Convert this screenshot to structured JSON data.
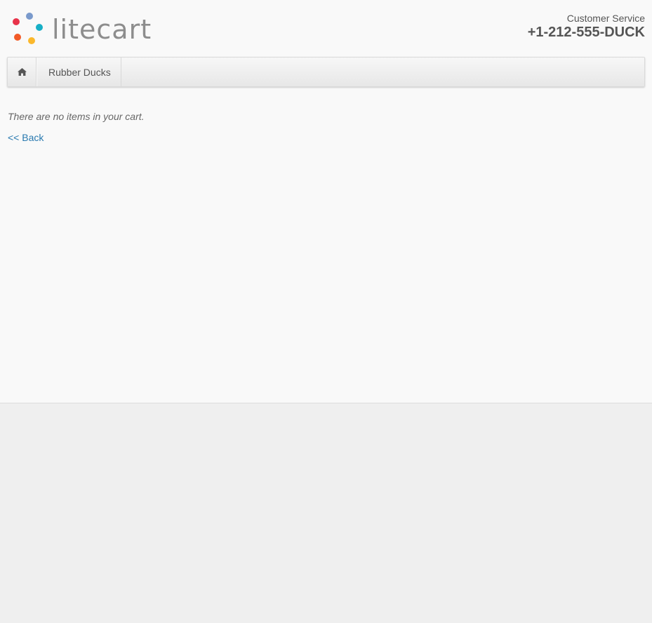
{
  "header": {
    "logo_text": "litecart",
    "logo_colors": [
      "#e8334a",
      "#7a9acc",
      "#17afc6",
      "#f25a27",
      "#fbb82c"
    ],
    "customer_service_label": "Customer Service",
    "customer_service_phone": "+1-212-555-DUCK"
  },
  "navbar": {
    "home_icon": "home-icon",
    "items": [
      {
        "label": "Rubber Ducks"
      }
    ]
  },
  "cart": {
    "empty_message": "There are no items in your cart.",
    "back_link": "<< Back"
  },
  "colors": {
    "link": "#2a7ab0",
    "background_main": "#f9f9f9",
    "background_footer": "#efefef"
  }
}
